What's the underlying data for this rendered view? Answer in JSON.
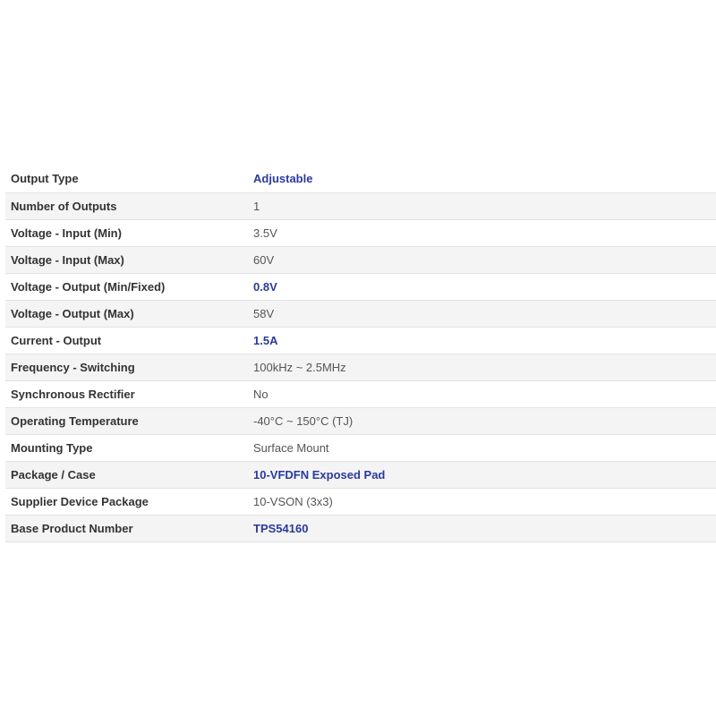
{
  "specs": [
    {
      "label": "Output Type",
      "value": "Adjustable",
      "link": true
    },
    {
      "label": "Number of Outputs",
      "value": "1",
      "link": false
    },
    {
      "label": "Voltage - Input (Min)",
      "value": "3.5V",
      "link": false
    },
    {
      "label": "Voltage - Input (Max)",
      "value": "60V",
      "link": false
    },
    {
      "label": "Voltage - Output (Min/Fixed)",
      "value": "0.8V",
      "link": true
    },
    {
      "label": "Voltage - Output (Max)",
      "value": "58V",
      "link": false
    },
    {
      "label": "Current - Output",
      "value": "1.5A",
      "link": true
    },
    {
      "label": "Frequency - Switching",
      "value": "100kHz ~ 2.5MHz",
      "link": false
    },
    {
      "label": "Synchronous Rectifier",
      "value": "No",
      "link": false
    },
    {
      "label": "Operating Temperature",
      "value": "-40°C ~ 150°C (TJ)",
      "link": false
    },
    {
      "label": "Mounting Type",
      "value": "Surface Mount",
      "link": false
    },
    {
      "label": "Package / Case",
      "value": "10-VFDFN Exposed Pad",
      "link": true
    },
    {
      "label": "Supplier Device Package",
      "value": "10-VSON (3x3)",
      "link": false
    },
    {
      "label": "Base Product Number",
      "value": "TPS54160",
      "link": true
    }
  ],
  "colors": {
    "link": "#2a3a9e",
    "label": "#333333",
    "value": "#555555",
    "row_alt": "#f4f4f4",
    "divider": "#e3e3e3"
  }
}
